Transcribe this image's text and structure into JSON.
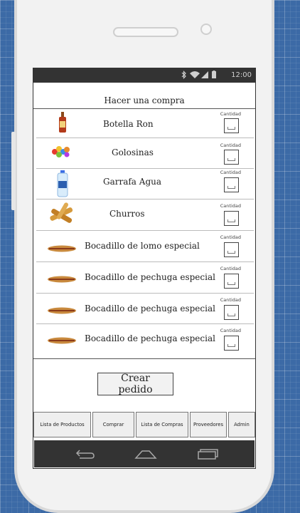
{
  "status_bar": {
    "time": "12:00",
    "icons": [
      "bluetooth-icon",
      "wifi-icon",
      "signal-icon",
      "battery-icon"
    ]
  },
  "screen_title": "Hacer una compra",
  "products": [
    {
      "name": "Botella Ron",
      "qty_label": "Cantidad",
      "icon": "rum-bottle-icon"
    },
    {
      "name": "Golosinas",
      "qty_label": "Cantidad",
      "icon": "candy-icon"
    },
    {
      "name": "Garrafa Agua",
      "qty_label": "Cantidad",
      "icon": "water-jug-icon"
    },
    {
      "name": "Churros",
      "qty_label": "Cantidad",
      "icon": "churros-icon"
    },
    {
      "name": "Bocadillo de lomo especial",
      "qty_label": "Cantidad",
      "icon": "sandwich-icon"
    },
    {
      "name": "Bocadillo de pechuga especial",
      "qty_label": "Cantidad",
      "icon": "sandwich-icon"
    },
    {
      "name": "Bocadillo de pechuga especial",
      "qty_label": "Cantidad",
      "icon": "sandwich-icon"
    },
    {
      "name": "Bocadillo de pechuga especial",
      "qty_label": "Cantidad",
      "icon": "sandwich-icon"
    }
  ],
  "create_button": "Crear pedido",
  "tabs": [
    "Lista de Productos",
    "Comprar",
    "Lista de Compras",
    "Proveedores",
    "Admin"
  ],
  "nav": {
    "icons": [
      "back-icon",
      "home-icon",
      "recent-apps-icon"
    ]
  }
}
